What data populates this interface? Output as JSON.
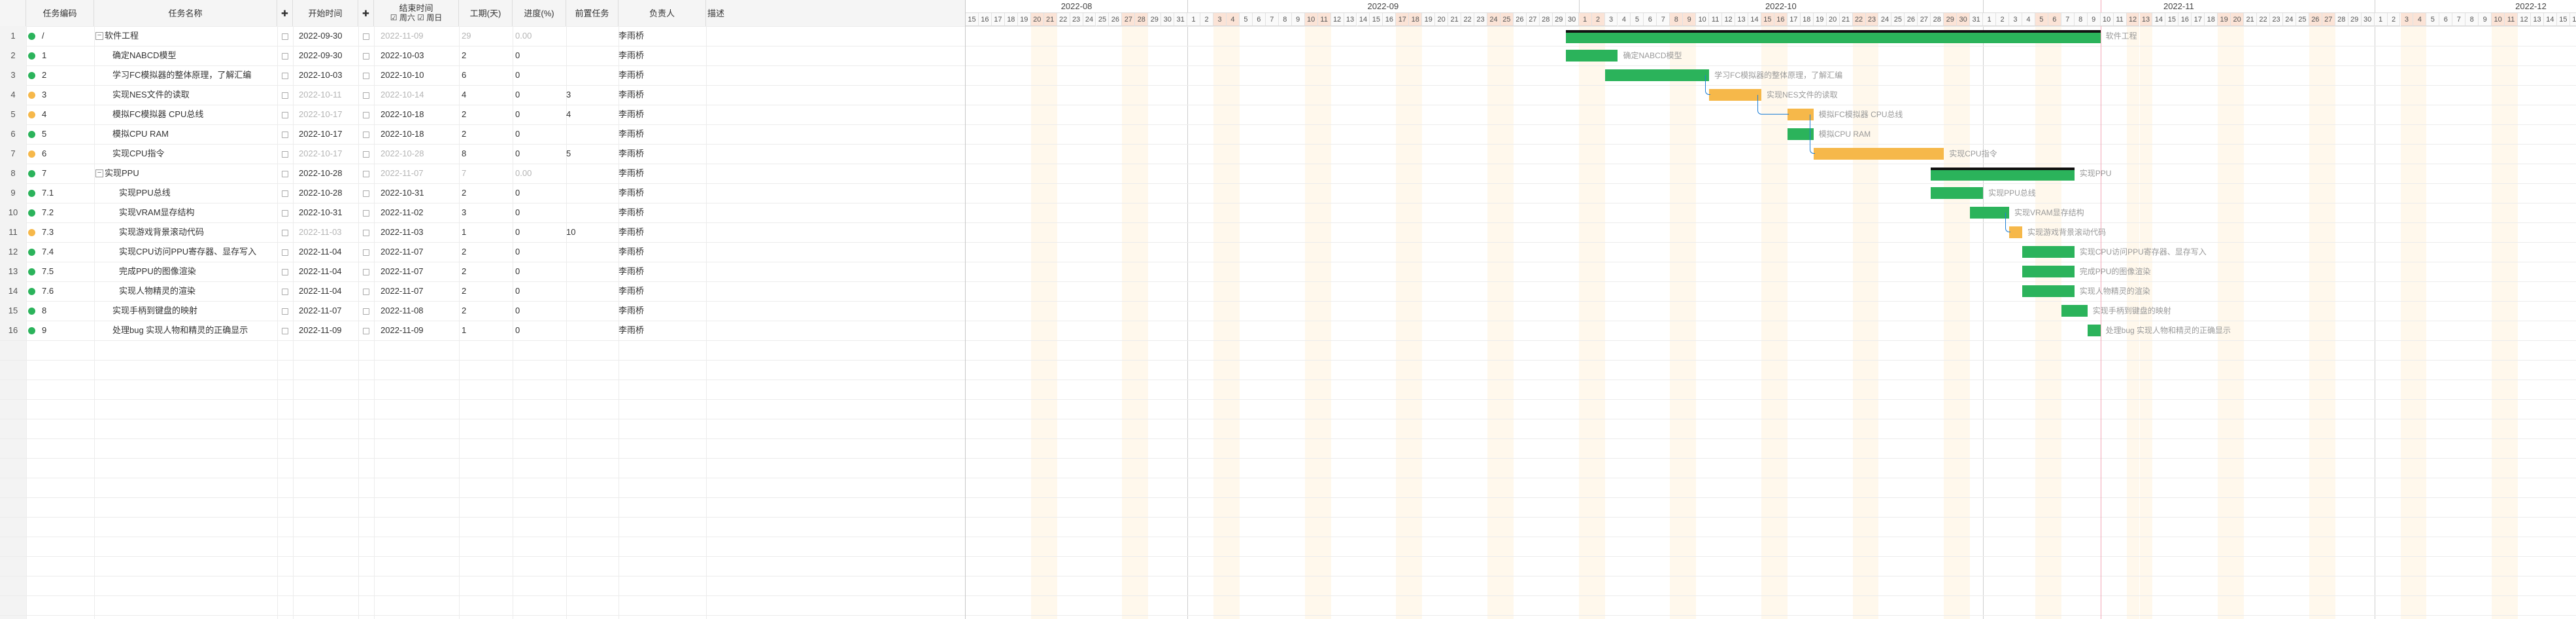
{
  "columns": {
    "code": "任务编码",
    "name": "任务名称",
    "start": "开始时间",
    "end_line1": "结束时间",
    "end_line2": "☑ 周六 ☑ 周日",
    "duration": "工期(天)",
    "progress": "进度(%)",
    "predecessor": "前置任务",
    "owner": "负责人",
    "desc": "描述"
  },
  "tasks": [
    {
      "num": "1",
      "status": "green",
      "code": "/",
      "name": "软件工程",
      "summary": true,
      "start": "2022-09-30",
      "end": "2022-11-09",
      "end_grey": true,
      "duration": "29",
      "duration_grey": true,
      "progress": "0.00",
      "progress_grey": true,
      "pred": "",
      "owner": "李雨桥",
      "level": 0
    },
    {
      "num": "2",
      "status": "green",
      "code": "1",
      "name": "确定NABCD模型",
      "summary": false,
      "start": "2022-09-30",
      "end": "2022-10-03",
      "end_grey": false,
      "duration": "2",
      "duration_grey": false,
      "progress": "0",
      "progress_grey": false,
      "pred": "",
      "owner": "李雨桥",
      "level": 1
    },
    {
      "num": "3",
      "status": "green",
      "code": "2",
      "name": "学习FC模拟器的整体原理，了解汇编",
      "summary": false,
      "start": "2022-10-03",
      "end": "2022-10-10",
      "end_grey": false,
      "duration": "6",
      "duration_grey": false,
      "progress": "0",
      "progress_grey": false,
      "pred": "",
      "owner": "李雨桥",
      "level": 1
    },
    {
      "num": "4",
      "status": "orange",
      "code": "3",
      "name": "实现NES文件的读取",
      "summary": false,
      "start": "2022-10-11",
      "end": "2022-10-14",
      "end_grey": true,
      "duration": "4",
      "duration_grey": false,
      "progress": "0",
      "progress_grey": false,
      "pred": "3",
      "owner": "李雨桥",
      "level": 1,
      "start_grey": true
    },
    {
      "num": "5",
      "status": "orange",
      "code": "4",
      "name": "模拟FC模拟器 CPU总线",
      "summary": false,
      "start": "2022-10-17",
      "end": "2022-10-18",
      "end_grey": false,
      "duration": "2",
      "duration_grey": false,
      "progress": "0",
      "progress_grey": false,
      "pred": "4",
      "owner": "李雨桥",
      "level": 1,
      "start_grey": true
    },
    {
      "num": "6",
      "status": "green",
      "code": "5",
      "name": "模拟CPU RAM",
      "summary": false,
      "start": "2022-10-17",
      "end": "2022-10-18",
      "end_grey": false,
      "duration": "2",
      "duration_grey": false,
      "progress": "0",
      "progress_grey": false,
      "pred": "",
      "owner": "李雨桥",
      "level": 1
    },
    {
      "num": "7",
      "status": "orange",
      "code": "6",
      "name": "实现CPU指令",
      "summary": false,
      "start": "2022-10-17",
      "end": "2022-10-28",
      "end_grey": false,
      "duration": "8",
      "duration_grey": false,
      "progress": "0",
      "progress_grey": false,
      "pred": "5",
      "owner": "李雨桥",
      "level": 1,
      "start_grey": true,
      "end_grey2": true
    },
    {
      "num": "8",
      "status": "green",
      "code": "7",
      "name": "实现PPU",
      "summary": true,
      "start": "2022-10-28",
      "end": "2022-11-07",
      "end_grey": true,
      "duration": "7",
      "duration_grey": true,
      "progress": "0.00",
      "progress_grey": true,
      "pred": "",
      "owner": "李雨桥",
      "level": 0
    },
    {
      "num": "9",
      "status": "green",
      "code": "7.1",
      "name": "实现PPU总线",
      "summary": false,
      "start": "2022-10-28",
      "end": "2022-10-31",
      "end_grey": false,
      "duration": "2",
      "duration_grey": false,
      "progress": "0",
      "progress_grey": false,
      "pred": "",
      "owner": "李雨桥",
      "level": 2
    },
    {
      "num": "10",
      "status": "green",
      "code": "7.2",
      "name": "实现VRAM显存结构",
      "summary": false,
      "start": "2022-10-31",
      "end": "2022-11-02",
      "end_grey": false,
      "duration": "3",
      "duration_grey": false,
      "progress": "0",
      "progress_grey": false,
      "pred": "",
      "owner": "李雨桥",
      "level": 2
    },
    {
      "num": "11",
      "status": "orange",
      "code": "7.3",
      "name": "实现游戏背景滚动代码",
      "summary": false,
      "start": "2022-11-03",
      "end": "2022-11-03",
      "end_grey": false,
      "duration": "1",
      "duration_grey": false,
      "progress": "0",
      "progress_grey": false,
      "pred": "10",
      "owner": "李雨桥",
      "level": 2,
      "start_grey": true
    },
    {
      "num": "12",
      "status": "green",
      "code": "7.4",
      "name": "实现CPU访问PPU寄存器、显存写入",
      "summary": false,
      "start": "2022-11-04",
      "end": "2022-11-07",
      "end_grey": false,
      "duration": "2",
      "duration_grey": false,
      "progress": "0",
      "progress_grey": false,
      "pred": "",
      "owner": "李雨桥",
      "level": 2
    },
    {
      "num": "13",
      "status": "green",
      "code": "7.5",
      "name": "完成PPU的图像渲染",
      "summary": false,
      "start": "2022-11-04",
      "end": "2022-11-07",
      "end_grey": false,
      "duration": "2",
      "duration_grey": false,
      "progress": "0",
      "progress_grey": false,
      "pred": "",
      "owner": "李雨桥",
      "level": 2
    },
    {
      "num": "14",
      "status": "green",
      "code": "7.6",
      "name": "实现人物精灵的渲染",
      "summary": false,
      "start": "2022-11-04",
      "end": "2022-11-07",
      "end_grey": false,
      "duration": "2",
      "duration_grey": false,
      "progress": "0",
      "progress_grey": false,
      "pred": "",
      "owner": "李雨桥",
      "level": 2
    },
    {
      "num": "15",
      "status": "green",
      "code": "8",
      "name": "实现手柄到键盘的映射",
      "summary": false,
      "start": "2022-11-07",
      "end": "2022-11-08",
      "end_grey": false,
      "duration": "2",
      "duration_grey": false,
      "progress": "0",
      "progress_grey": false,
      "pred": "",
      "owner": "李雨桥",
      "level": 1
    },
    {
      "num": "16",
      "status": "green",
      "code": "9",
      "name": "处理bug 实现人物和精灵的正确显示",
      "summary": false,
      "start": "2022-11-09",
      "end": "2022-11-09",
      "end_grey": false,
      "duration": "1",
      "duration_grey": false,
      "progress": "0",
      "progress_grey": false,
      "pred": "",
      "owner": "李雨桥",
      "level": 1
    }
  ],
  "gantt": {
    "timeline_start": "2022-08-15",
    "months": [
      {
        "label": "2022-08",
        "days": 17
      },
      {
        "label": "2022-09",
        "days": 30
      },
      {
        "label": "2022-10",
        "days": 31
      },
      {
        "label": "2022-11",
        "days": 30
      },
      {
        "label": "2022-12",
        "days": 24
      }
    ],
    "today": "2022-11-10",
    "bars": [
      {
        "row": 0,
        "start": "2022-09-30",
        "end": "2022-11-09",
        "type": "summary",
        "label": "软件工程"
      },
      {
        "row": 1,
        "start": "2022-09-30",
        "end": "2022-10-03",
        "type": "green",
        "label": "确定NABCD模型"
      },
      {
        "row": 2,
        "start": "2022-10-03",
        "end": "2022-10-10",
        "type": "green",
        "label": "学习FC模拟器的整体原理，了解汇编"
      },
      {
        "row": 3,
        "start": "2022-10-11",
        "end": "2022-10-14",
        "type": "orange",
        "label": "实现NES文件的读取"
      },
      {
        "row": 4,
        "start": "2022-10-17",
        "end": "2022-10-18",
        "type": "orange",
        "label": "模拟FC模拟器 CPU总线"
      },
      {
        "row": 5,
        "start": "2022-10-17",
        "end": "2022-10-18",
        "type": "green",
        "label": "模拟CPU RAM"
      },
      {
        "row": 6,
        "start": "2022-10-19",
        "end": "2022-10-28",
        "type": "orange",
        "label": "实现CPU指令"
      },
      {
        "row": 7,
        "start": "2022-10-28",
        "end": "2022-11-07",
        "type": "summary",
        "label": "实现PPU"
      },
      {
        "row": 8,
        "start": "2022-10-28",
        "end": "2022-10-31",
        "type": "green",
        "label": "实现PPU总线"
      },
      {
        "row": 9,
        "start": "2022-10-31",
        "end": "2022-11-02",
        "type": "green",
        "label": "实现VRAM显存结构"
      },
      {
        "row": 10,
        "start": "2022-11-03",
        "end": "2022-11-03",
        "type": "orange",
        "label": "实现游戏背景滚动代码"
      },
      {
        "row": 11,
        "start": "2022-11-04",
        "end": "2022-11-07",
        "type": "green",
        "label": "实现CPU访问PPU寄存器、显存写入"
      },
      {
        "row": 12,
        "start": "2022-11-04",
        "end": "2022-11-07",
        "type": "green",
        "label": "完成PPU的图像渲染"
      },
      {
        "row": 13,
        "start": "2022-11-04",
        "end": "2022-11-07",
        "type": "green",
        "label": "实现人物精灵的渲染"
      },
      {
        "row": 14,
        "start": "2022-11-07",
        "end": "2022-11-08",
        "type": "green",
        "label": "实现手柄到键盘的映射"
      },
      {
        "row": 15,
        "start": "2022-11-09",
        "end": "2022-11-09",
        "type": "green",
        "label": "处理bug 实现人物和精灵的正确显示"
      }
    ],
    "links": [
      {
        "from": 2,
        "to": 3
      },
      {
        "from": 3,
        "to": 4
      },
      {
        "from": 4,
        "to": 6
      },
      {
        "from": 9,
        "to": 10
      }
    ]
  },
  "colors": {
    "green": "#2bb35b",
    "orange": "#f6b84a",
    "weekend": "#fbe3d6",
    "today": "#f3a4b5",
    "link": "#1e7fd6"
  }
}
